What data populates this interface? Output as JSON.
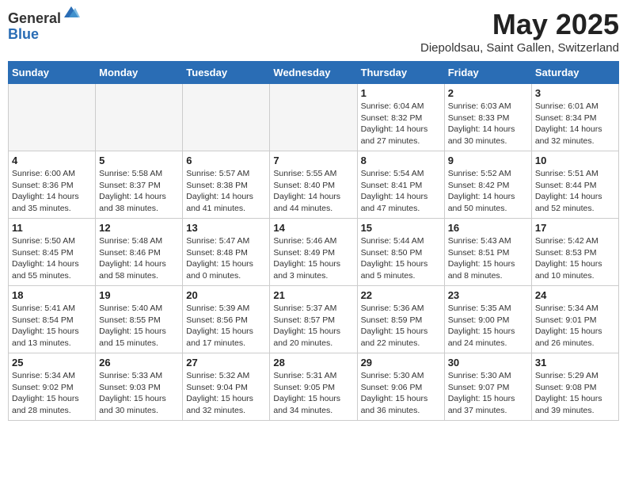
{
  "logo": {
    "general": "General",
    "blue": "Blue"
  },
  "title": "May 2025",
  "subtitle": "Diepoldsau, Saint Gallen, Switzerland",
  "days_of_week": [
    "Sunday",
    "Monday",
    "Tuesday",
    "Wednesday",
    "Thursday",
    "Friday",
    "Saturday"
  ],
  "weeks": [
    [
      {
        "day": "",
        "info": ""
      },
      {
        "day": "",
        "info": ""
      },
      {
        "day": "",
        "info": ""
      },
      {
        "day": "",
        "info": ""
      },
      {
        "day": "1",
        "info": "Sunrise: 6:04 AM\nSunset: 8:32 PM\nDaylight: 14 hours and 27 minutes."
      },
      {
        "day": "2",
        "info": "Sunrise: 6:03 AM\nSunset: 8:33 PM\nDaylight: 14 hours and 30 minutes."
      },
      {
        "day": "3",
        "info": "Sunrise: 6:01 AM\nSunset: 8:34 PM\nDaylight: 14 hours and 32 minutes."
      }
    ],
    [
      {
        "day": "4",
        "info": "Sunrise: 6:00 AM\nSunset: 8:36 PM\nDaylight: 14 hours and 35 minutes."
      },
      {
        "day": "5",
        "info": "Sunrise: 5:58 AM\nSunset: 8:37 PM\nDaylight: 14 hours and 38 minutes."
      },
      {
        "day": "6",
        "info": "Sunrise: 5:57 AM\nSunset: 8:38 PM\nDaylight: 14 hours and 41 minutes."
      },
      {
        "day": "7",
        "info": "Sunrise: 5:55 AM\nSunset: 8:40 PM\nDaylight: 14 hours and 44 minutes."
      },
      {
        "day": "8",
        "info": "Sunrise: 5:54 AM\nSunset: 8:41 PM\nDaylight: 14 hours and 47 minutes."
      },
      {
        "day": "9",
        "info": "Sunrise: 5:52 AM\nSunset: 8:42 PM\nDaylight: 14 hours and 50 minutes."
      },
      {
        "day": "10",
        "info": "Sunrise: 5:51 AM\nSunset: 8:44 PM\nDaylight: 14 hours and 52 minutes."
      }
    ],
    [
      {
        "day": "11",
        "info": "Sunrise: 5:50 AM\nSunset: 8:45 PM\nDaylight: 14 hours and 55 minutes."
      },
      {
        "day": "12",
        "info": "Sunrise: 5:48 AM\nSunset: 8:46 PM\nDaylight: 14 hours and 58 minutes."
      },
      {
        "day": "13",
        "info": "Sunrise: 5:47 AM\nSunset: 8:48 PM\nDaylight: 15 hours and 0 minutes."
      },
      {
        "day": "14",
        "info": "Sunrise: 5:46 AM\nSunset: 8:49 PM\nDaylight: 15 hours and 3 minutes."
      },
      {
        "day": "15",
        "info": "Sunrise: 5:44 AM\nSunset: 8:50 PM\nDaylight: 15 hours and 5 minutes."
      },
      {
        "day": "16",
        "info": "Sunrise: 5:43 AM\nSunset: 8:51 PM\nDaylight: 15 hours and 8 minutes."
      },
      {
        "day": "17",
        "info": "Sunrise: 5:42 AM\nSunset: 8:53 PM\nDaylight: 15 hours and 10 minutes."
      }
    ],
    [
      {
        "day": "18",
        "info": "Sunrise: 5:41 AM\nSunset: 8:54 PM\nDaylight: 15 hours and 13 minutes."
      },
      {
        "day": "19",
        "info": "Sunrise: 5:40 AM\nSunset: 8:55 PM\nDaylight: 15 hours and 15 minutes."
      },
      {
        "day": "20",
        "info": "Sunrise: 5:39 AM\nSunset: 8:56 PM\nDaylight: 15 hours and 17 minutes."
      },
      {
        "day": "21",
        "info": "Sunrise: 5:37 AM\nSunset: 8:57 PM\nDaylight: 15 hours and 20 minutes."
      },
      {
        "day": "22",
        "info": "Sunrise: 5:36 AM\nSunset: 8:59 PM\nDaylight: 15 hours and 22 minutes."
      },
      {
        "day": "23",
        "info": "Sunrise: 5:35 AM\nSunset: 9:00 PM\nDaylight: 15 hours and 24 minutes."
      },
      {
        "day": "24",
        "info": "Sunrise: 5:34 AM\nSunset: 9:01 PM\nDaylight: 15 hours and 26 minutes."
      }
    ],
    [
      {
        "day": "25",
        "info": "Sunrise: 5:34 AM\nSunset: 9:02 PM\nDaylight: 15 hours and 28 minutes."
      },
      {
        "day": "26",
        "info": "Sunrise: 5:33 AM\nSunset: 9:03 PM\nDaylight: 15 hours and 30 minutes."
      },
      {
        "day": "27",
        "info": "Sunrise: 5:32 AM\nSunset: 9:04 PM\nDaylight: 15 hours and 32 minutes."
      },
      {
        "day": "28",
        "info": "Sunrise: 5:31 AM\nSunset: 9:05 PM\nDaylight: 15 hours and 34 minutes."
      },
      {
        "day": "29",
        "info": "Sunrise: 5:30 AM\nSunset: 9:06 PM\nDaylight: 15 hours and 36 minutes."
      },
      {
        "day": "30",
        "info": "Sunrise: 5:30 AM\nSunset: 9:07 PM\nDaylight: 15 hours and 37 minutes."
      },
      {
        "day": "31",
        "info": "Sunrise: 5:29 AM\nSunset: 9:08 PM\nDaylight: 15 hours and 39 minutes."
      }
    ]
  ]
}
